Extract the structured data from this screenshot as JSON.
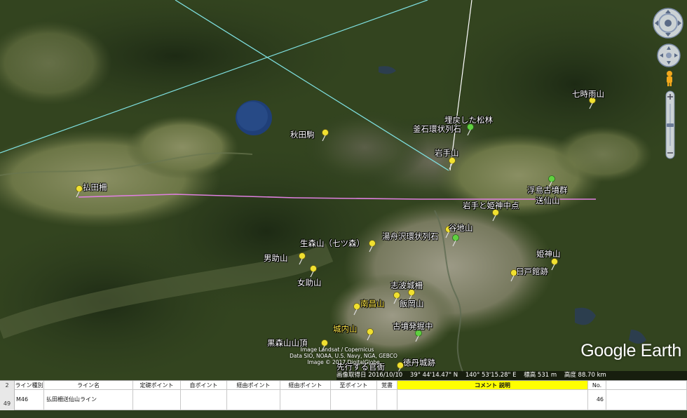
{
  "map": {
    "labels": [
      {
        "id": "shichijiu",
        "text": "七時雨山",
        "style": "white"
      },
      {
        "id": "umomodoshita",
        "text": "埋戻した松林",
        "style": "white"
      },
      {
        "id": "kaneishi",
        "text": "釜石環状列石",
        "style": "white"
      },
      {
        "id": "akitakoma",
        "text": "秋田駒",
        "style": "white"
      },
      {
        "id": "iwatesan",
        "text": "岩手山",
        "style": "white"
      },
      {
        "id": "hottanosaku",
        "text": "払田柵",
        "style": "white"
      },
      {
        "id": "ukishima",
        "text": "浮島古墳群",
        "style": "white"
      },
      {
        "id": "sosenzan",
        "text": "送仙山",
        "style": "white"
      },
      {
        "id": "iwatehime",
        "text": "岩手と姫神中点",
        "style": "white"
      },
      {
        "id": "tanichiyama",
        "text": "谷地山",
        "style": "white"
      },
      {
        "id": "yubunezawa",
        "text": "湯舟沢環状列石",
        "style": "white"
      },
      {
        "id": "oimori",
        "text": "生森山（七ツ森）",
        "style": "white"
      },
      {
        "id": "himekamisan",
        "text": "姫神山",
        "style": "white"
      },
      {
        "id": "otokosuke",
        "text": "男助山",
        "style": "white"
      },
      {
        "id": "hinotodate",
        "text": "日戸館跡",
        "style": "white"
      },
      {
        "id": "onnasuke",
        "text": "女助山",
        "style": "white"
      },
      {
        "id": "shiwajo",
        "text": "志波城柵",
        "style": "white"
      },
      {
        "id": "nanshozan",
        "text": "南昌山",
        "style": "yellow"
      },
      {
        "id": "iioka",
        "text": "飯岡山",
        "style": "white"
      },
      {
        "id": "kofun",
        "text": "古墳発掘中",
        "style": "white"
      },
      {
        "id": "jonai",
        "text": "城内山",
        "style": "yellow"
      },
      {
        "id": "kuromori",
        "text": "黒森山山頂",
        "style": "white"
      },
      {
        "id": "sakkan",
        "text": "先行する官衙",
        "style": "white"
      },
      {
        "id": "tokutan",
        "text": "徳丹城跡",
        "style": "white"
      }
    ],
    "credits": [
      "Image Landsat / Copernicus",
      "Data SIO, NOAA, U.S. Navy, NGA, GEBCO",
      "Image © 2017 DigitalGlobe"
    ],
    "status": {
      "date": "画像取得日 2016/10/10",
      "lat": "39° 44'14.47\" N",
      "lon": "140° 53'15.28\" E",
      "elev": "標高 531 m",
      "eye": "高度 88.70 km"
    },
    "logo": "Google Earth",
    "ctrl_icons": [
      "look-joystick-icon",
      "move-joystick-icon",
      "pegman-icon",
      "zoom-in-icon",
      "zoom-out-icon"
    ]
  },
  "sheet": {
    "row_numbers": [
      "2",
      "49"
    ],
    "headers": [
      "ライン種別",
      "ライン名",
      "定礎ポイント",
      "自ポイント",
      "経由ポイント",
      "経由ポイント",
      "至ポイント",
      "覚書",
      "コメント 説明",
      "No."
    ],
    "row": [
      "M46",
      "払田柵送仙山ライン",
      "",
      "",
      "",
      "",
      "",
      "",
      "",
      "46"
    ]
  }
}
